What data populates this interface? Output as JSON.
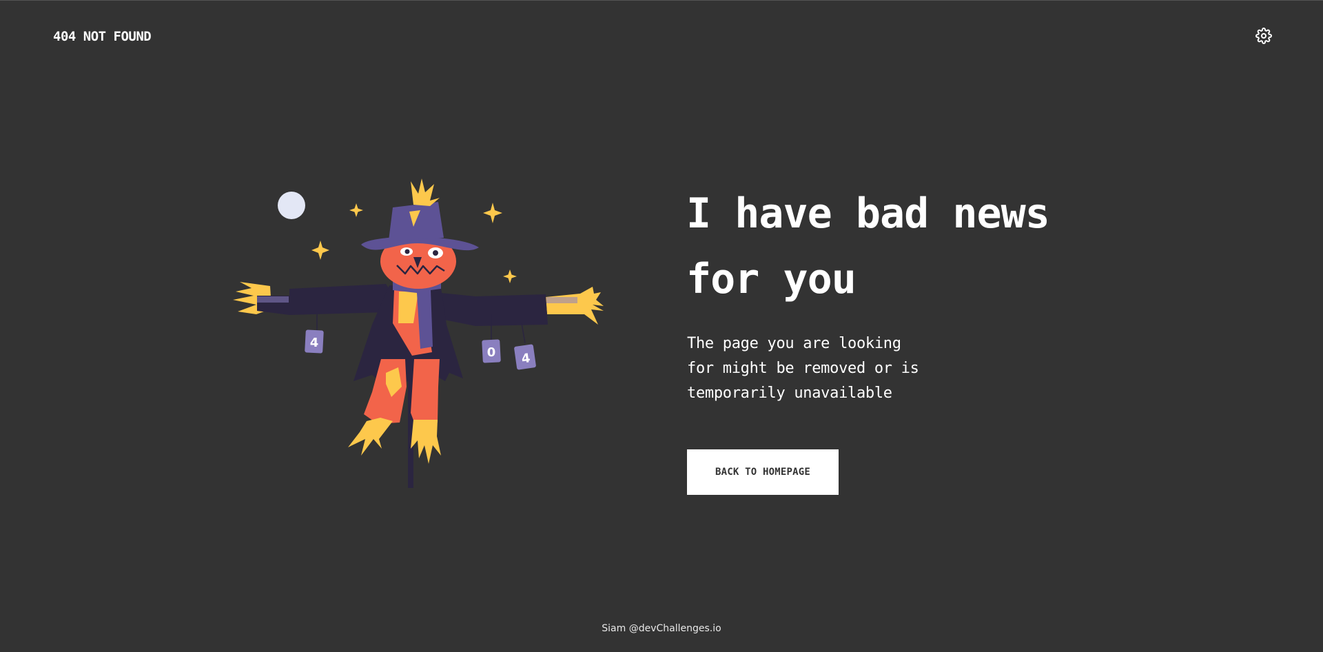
{
  "header": {
    "brand": "404 NOT FOUND",
    "settings_icon": "gear-icon"
  },
  "hero": {
    "illustration": "scarecrow-illustration",
    "can_labels": [
      "4",
      "0",
      "4"
    ]
  },
  "main": {
    "headline_line1": "I have bad news",
    "headline_line2": "for you",
    "description_line1": "The page you are looking",
    "description_line2": "for might be removed or is",
    "description_line3": "temporarily unavailable",
    "cta_label": "BACK TO HOMEPAGE"
  },
  "footer": {
    "credit": "Siam @devChallenges.io"
  },
  "colors": {
    "background": "#333333",
    "text": "#ffffff",
    "button_bg": "#ffffff",
    "button_text": "#333333",
    "scarecrow_coat": "#2b2540",
    "scarecrow_hat": "#5d5295",
    "scarecrow_face": "#f2644a",
    "straw": "#fdc84c",
    "moon": "#e3e7f5"
  }
}
